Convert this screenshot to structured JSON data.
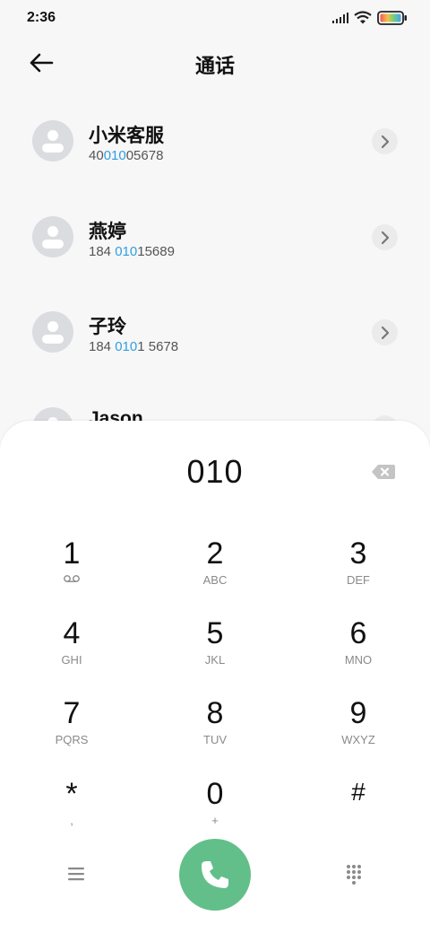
{
  "status_bar": {
    "time": "2:36"
  },
  "header": {
    "title": "通话"
  },
  "contacts": [
    {
      "name": "小米客服",
      "number_pre": "40",
      "number_match": "010",
      "number_post": "05678"
    },
    {
      "name": "燕婷",
      "number_pre": "184 ",
      "number_match": "010",
      "number_post": "15689"
    },
    {
      "name": "子玲",
      "number_pre": "184 ",
      "number_match": "010",
      "number_post": "1 5678"
    },
    {
      "name": "Jason",
      "number_pre": "",
      "number_match": "",
      "number_post": ""
    }
  ],
  "dialer": {
    "input_value": "010",
    "keys": [
      {
        "digit": "1",
        "letters": ""
      },
      {
        "digit": "2",
        "letters": "ABC"
      },
      {
        "digit": "3",
        "letters": "DEF"
      },
      {
        "digit": "4",
        "letters": "GHI"
      },
      {
        "digit": "5",
        "letters": "JKL"
      },
      {
        "digit": "6",
        "letters": "MNO"
      },
      {
        "digit": "7",
        "letters": "PQRS"
      },
      {
        "digit": "8",
        "letters": "TUV"
      },
      {
        "digit": "9",
        "letters": "WXYZ"
      },
      {
        "digit": "*",
        "letters": ","
      },
      {
        "digit": "0",
        "letters": "+"
      },
      {
        "digit": "#",
        "letters": ""
      }
    ]
  },
  "icons": {
    "key1_sub": "voicemail-icon",
    "call": "phone-icon",
    "menu": "menu-icon",
    "keypad": "keypad-icon"
  },
  "colors": {
    "match_highlight": "#2f9fe0",
    "call_button": "#63bf89",
    "background": "#f7f7f7"
  }
}
